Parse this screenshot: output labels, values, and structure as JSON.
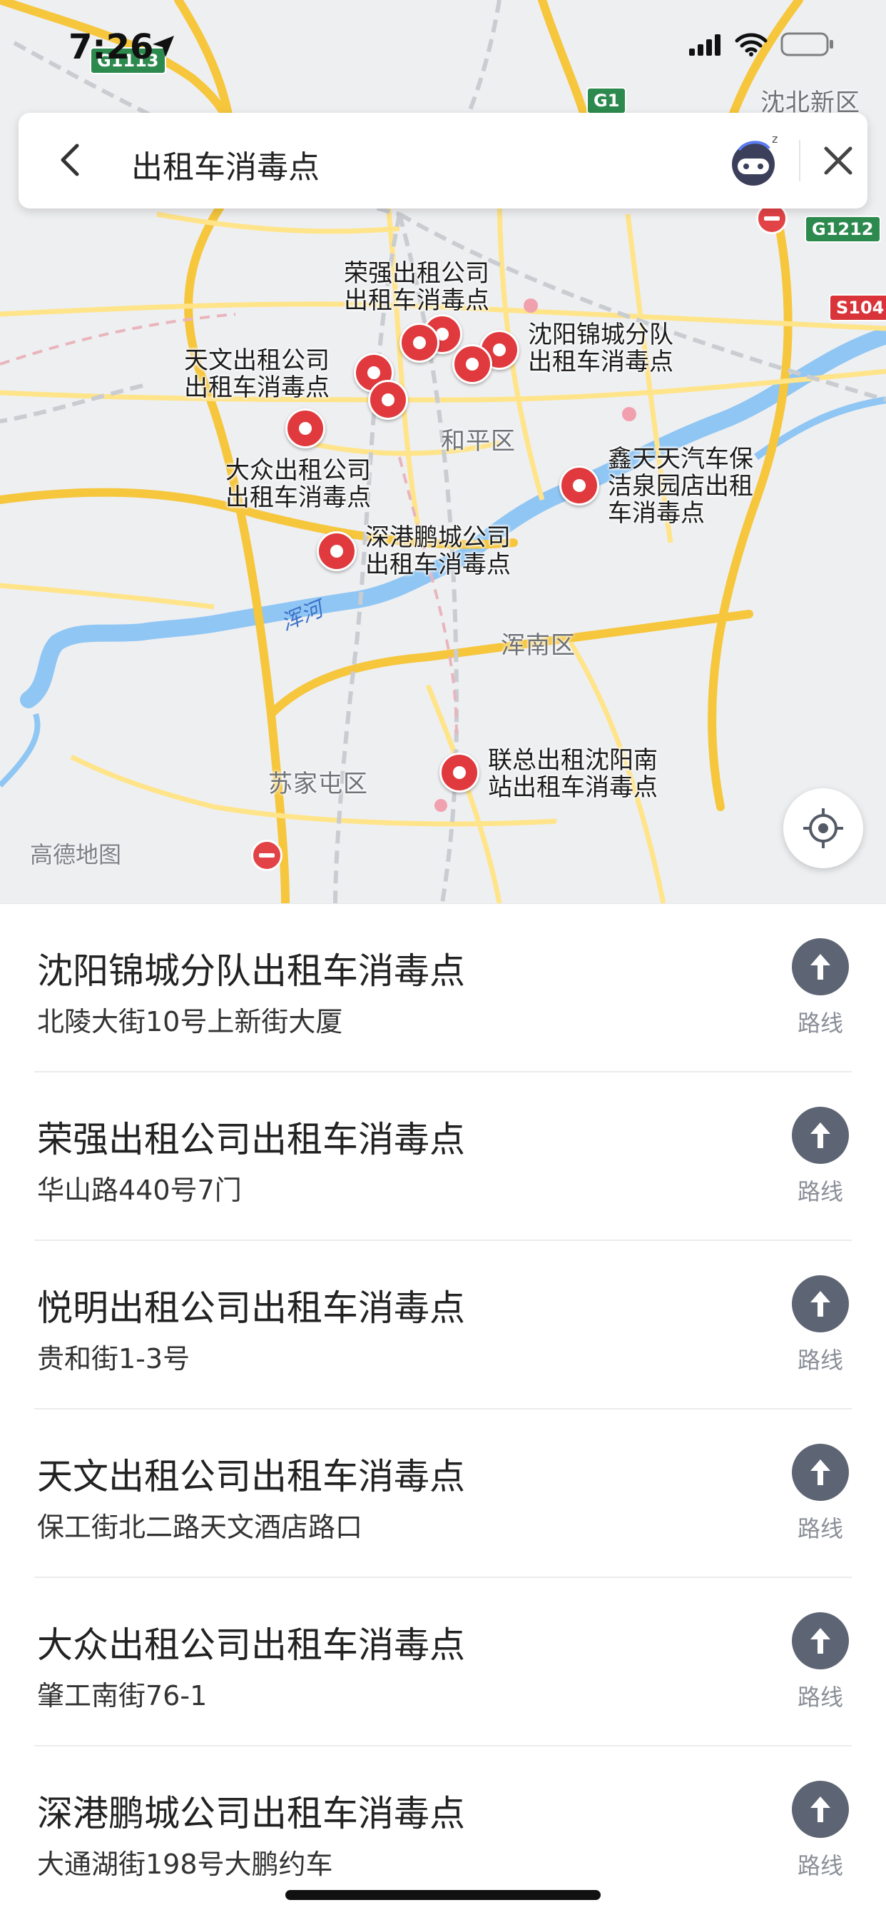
{
  "status_bar": {
    "time": "7:26"
  },
  "search": {
    "query": "出租车消毒点"
  },
  "map": {
    "districts": [
      "和平区",
      "浑南区",
      "苏家屯区",
      "沈北新区"
    ],
    "river": "浑河",
    "watermark": "高德地图",
    "shields": [
      "G1113",
      "G1",
      "G1212",
      "S104"
    ],
    "poi_labels": [
      "荣强出租公司\n出租车消毒点",
      "沈阳锦城分队\n出租车消毒点",
      "天文出租公司\n出租车消毒点",
      "大众出租公司\n出租车消毒点",
      "鑫天天汽车保\n洁泉园店出租\n车消毒点",
      "深港鹏城公司\n出租车消毒点",
      "联总出租沈阳南\n站出租车消毒点"
    ]
  },
  "results": [
    {
      "name": "沈阳锦城分队出租车消毒点",
      "address": "北陵大街10号上新街大厦",
      "route_label": "路线"
    },
    {
      "name": "荣强出租公司出租车消毒点",
      "address": "华山路440号7门",
      "route_label": "路线"
    },
    {
      "name": "悦明出租公司出租车消毒点",
      "address": "贵和街1-3号",
      "route_label": "路线"
    },
    {
      "name": "天文出租公司出租车消毒点",
      "address": "保工街北二路天文酒店路口",
      "route_label": "路线"
    },
    {
      "name": "大众出租公司出租车消毒点",
      "address": "肇工南街76-1",
      "route_label": "路线"
    },
    {
      "name": "深港鹏城公司出租车消毒点",
      "address": "大通湖街198号大鹏约车",
      "route_label": "路线"
    }
  ],
  "colors": {
    "pin": "#e03a3e",
    "road_major": "#f6c63c",
    "river": "#8fc6f4",
    "route_button": "#5d6473"
  }
}
